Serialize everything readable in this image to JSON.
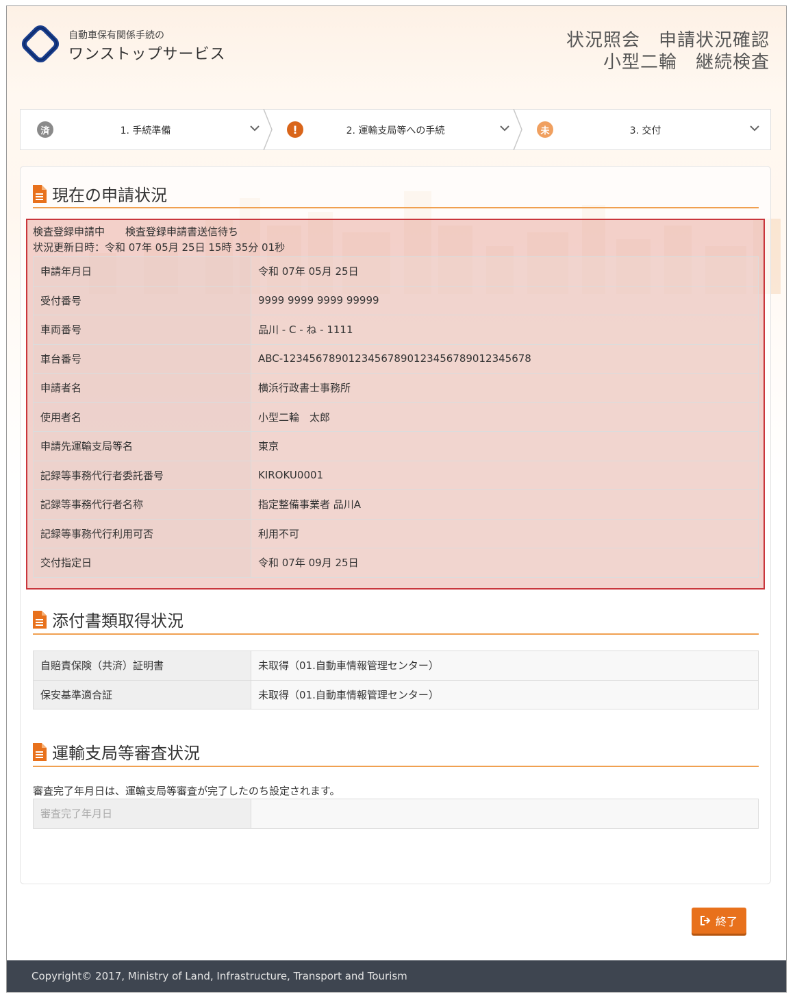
{
  "header": {
    "brand_sub": "自動車保有関係手続の",
    "brand_main": "ワンストップサービス",
    "title_line1": "状況照会　申請状況確認",
    "title_line2": "小型二輪　継続検査"
  },
  "steps": [
    {
      "badge": "済",
      "label": "1. 手続準備",
      "badge_color": "#8a8a8a"
    },
    {
      "badge": "!",
      "label": "2. 運輸支局等への手続",
      "badge_color": "#d9651a"
    },
    {
      "badge": "未",
      "label": "3. 交付",
      "badge_color": "#f0a060"
    }
  ],
  "current": {
    "title": "現在の申請状況",
    "status_line1": "検査登録申請中　　検査登録申請書送信待ち",
    "status_line2": "状況更新日時：令和 07年 05月 25日 15時 35分 01秒",
    "rows": [
      {
        "k": "申請年月日",
        "v": "令和 07年 05月 25日"
      },
      {
        "k": "受付番号",
        "v": "9999 9999 9999 99999"
      },
      {
        "k": "車両番号",
        "v": "品川 - C - ね - 1111"
      },
      {
        "k": "車台番号",
        "v": "ABC-12345678901234567890123456789012345678"
      },
      {
        "k": "申請者名",
        "v": "横浜行政書士事務所"
      },
      {
        "k": "使用者名",
        "v": "小型二輪　太郎"
      },
      {
        "k": "申請先運輸支局等名",
        "v": "東京"
      },
      {
        "k": "記録等事務代行者委託番号",
        "v": "KIROKU0001"
      },
      {
        "k": "記録等事務代行者名称",
        "v": "指定整備事業者 品川A"
      },
      {
        "k": "記録等事務代行利用可否",
        "v": "利用不可"
      },
      {
        "k": "交付指定日",
        "v": "令和 07年 09月 25日"
      }
    ]
  },
  "attachments": {
    "title": "添付書類取得状況",
    "rows": [
      {
        "k": "自賠責保険（共済）証明書",
        "v": "未取得（01.自動車情報管理センター）"
      },
      {
        "k": "保安基準適合証",
        "v": "未取得（01.自動車情報管理センター）"
      }
    ]
  },
  "review": {
    "title": "運輸支局等審査状況",
    "note": "審査完了年月日は、運輸支局等審査が完了したのち設定されます。",
    "rows": [
      {
        "k": "審査完了年月日",
        "v": ""
      }
    ]
  },
  "actions": {
    "end_label": "終了"
  },
  "footer": {
    "copyright": "Copyright© 2017, Ministry of Land, Infrastructure, Transport and Tourism"
  },
  "colors": {
    "accent": "#e8711c",
    "highlight_border": "#c9363c",
    "footer_bg": "#3e4550"
  }
}
